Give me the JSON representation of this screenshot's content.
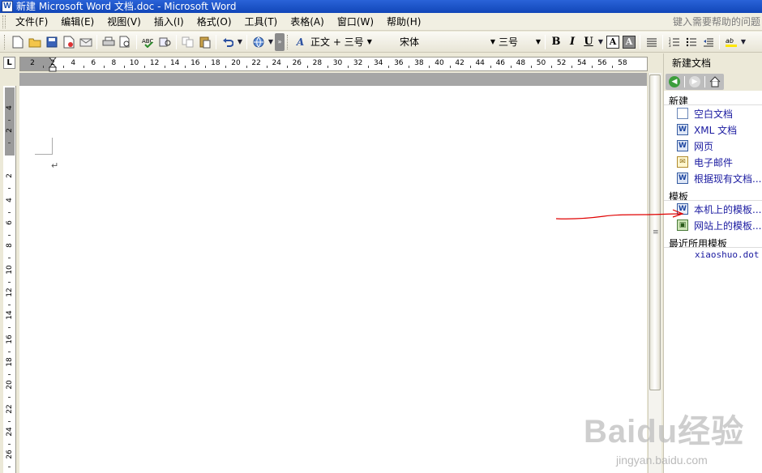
{
  "window": {
    "title": "新建 Microsoft Word 文档.doc - Microsoft Word",
    "app_icon": "W"
  },
  "menubar": {
    "items": [
      {
        "label": "文件(F)"
      },
      {
        "label": "编辑(E)"
      },
      {
        "label": "视图(V)"
      },
      {
        "label": "插入(I)"
      },
      {
        "label": "格式(O)"
      },
      {
        "label": "工具(T)"
      },
      {
        "label": "表格(A)"
      },
      {
        "label": "窗口(W)"
      },
      {
        "label": "帮助(H)"
      }
    ],
    "help_placeholder": "键入需要帮助的问题"
  },
  "toolbar": {
    "icons": [
      "new-doc",
      "open",
      "save",
      "permission",
      "print",
      "print-preview",
      "spelling",
      "research",
      "copy",
      "paste",
      "undo",
      "hyperlink"
    ],
    "style_value": "正文 + 三号",
    "font_value": "宋体",
    "size_value": "三号",
    "bold_label": "B",
    "italic_label": "I",
    "underline_label": "U",
    "border_label": "A",
    "shading_label": "A",
    "style_icon_label": "A"
  },
  "ruler": {
    "corner_label": "L",
    "labels": [
      "2",
      "2",
      "4",
      "6",
      "8",
      "10",
      "12",
      "14",
      "16",
      "18",
      "20",
      "22",
      "24",
      "26",
      "28",
      "30",
      "32",
      "34",
      "36",
      "38",
      "40",
      "42",
      "44",
      "46",
      "48",
      "50",
      "52",
      "54",
      "56",
      "58"
    ],
    "vertical_labels": [
      "4",
      "2",
      "2",
      "4",
      "6",
      "8",
      "10",
      "12",
      "14",
      "16",
      "18",
      "20",
      "22",
      "24",
      "26"
    ]
  },
  "document": {
    "paragraph_mark": "↵"
  },
  "taskpane": {
    "title": "新建文档",
    "sections": {
      "new": {
        "heading": "新建",
        "links": [
          "空白文档",
          "XML 文档",
          "网页",
          "电子邮件",
          "根据现有文档..."
        ]
      },
      "templates": {
        "heading": "模板",
        "links": [
          "本机上的模板...",
          "网站上的模板..."
        ]
      },
      "recent": {
        "heading": "最近所用模板",
        "items": [
          "xiaoshuo.dot"
        ]
      }
    }
  },
  "watermark": {
    "logo": "Baidu经验",
    "url": "jingyan.baidu.com"
  },
  "colors": {
    "title_bar": "#1a52c4",
    "link": "#1a1aa0",
    "annotation": "#e00000"
  }
}
